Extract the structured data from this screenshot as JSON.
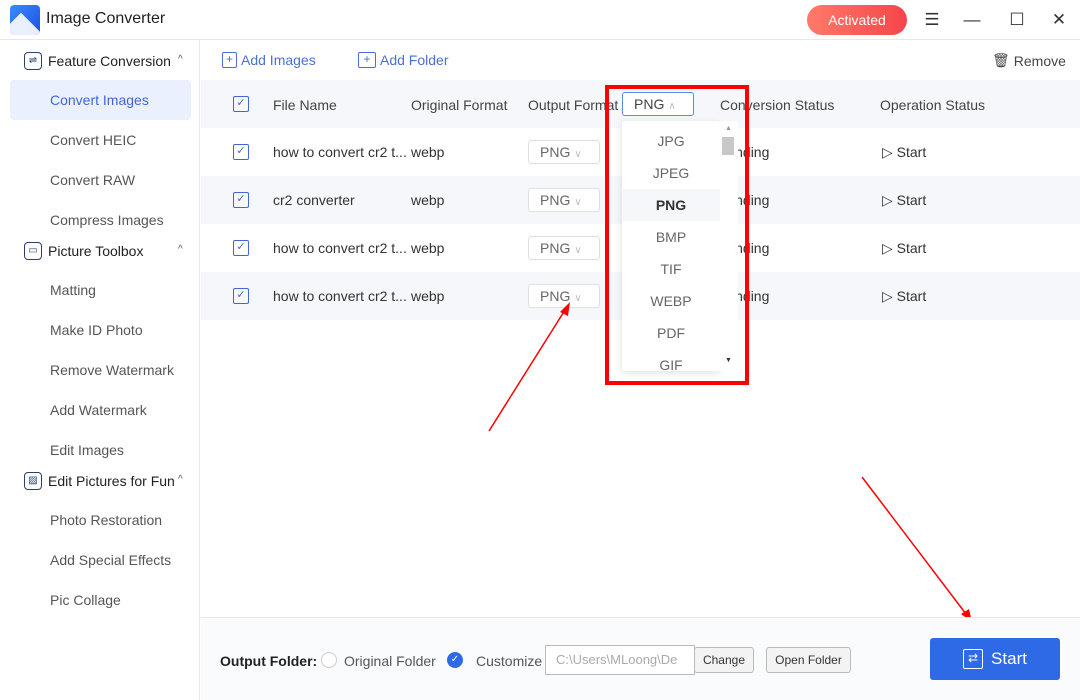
{
  "app": {
    "title": "Image Converter",
    "activated_label": "Activated"
  },
  "window": {
    "menu_icon": "hamburger-icon",
    "minimize_icon": "minimize-icon",
    "maximize_icon": "maximize-icon",
    "close_icon": "close-icon"
  },
  "sidebar": {
    "sections": [
      {
        "label": "Feature Conversion",
        "icon": "convert-hexagon-icon",
        "items": [
          "Convert Images",
          "Convert HEIC",
          "Convert RAW",
          "Compress Images"
        ]
      },
      {
        "label": "Picture Toolbox",
        "icon": "toolbox-icon",
        "items": [
          "Matting",
          "Make ID Photo",
          "Remove Watermark",
          "Add Watermark",
          "Edit Images"
        ]
      },
      {
        "label": "Edit Pictures for Fun",
        "icon": "picture-icon",
        "items": [
          "Photo Restoration",
          "Add Special Effects",
          "Pic Collage"
        ]
      }
    ],
    "active_item": "Convert Images"
  },
  "toolbar": {
    "add_images": "Add Images",
    "add_folder": "Add Folder",
    "remove": "Remove"
  },
  "table": {
    "headers": [
      "File Name",
      "Original Format",
      "Output Format",
      "Conversion Status",
      "Operation Status"
    ],
    "header_format": "PNG",
    "rows": [
      {
        "name": "how to convert cr2 t...",
        "format": "webp",
        "output": "PNG",
        "status": "Pending",
        "action": "Start"
      },
      {
        "name": "cr2 converter",
        "format": "webp",
        "output": "PNG",
        "status": "Pending",
        "action": "Start"
      },
      {
        "name": "how to convert cr2 t...",
        "format": "webp",
        "output": "PNG",
        "status": "Pending",
        "action": "Start"
      },
      {
        "name": "how to convert cr2 t...",
        "format": "webp",
        "output": "PNG",
        "status": "Pending",
        "action": "Start"
      }
    ]
  },
  "dropdown": {
    "options": [
      "JPG",
      "JPEG",
      "PNG",
      "BMP",
      "TIF",
      "WEBP",
      "PDF",
      "GIF"
    ],
    "selected": "PNG"
  },
  "footer": {
    "label": "Output Folder:",
    "option_original": "Original Folder",
    "option_customize": "Customize",
    "selected": "Customize",
    "path": "C:\\Users\\MLoong\\De",
    "change": "Change",
    "open_folder": "Open Folder",
    "start": "Start"
  },
  "colors": {
    "accent": "#3f67d8",
    "start_button": "#2f6ae6",
    "annotation": "#ff0000",
    "activated": "#f5454a"
  }
}
